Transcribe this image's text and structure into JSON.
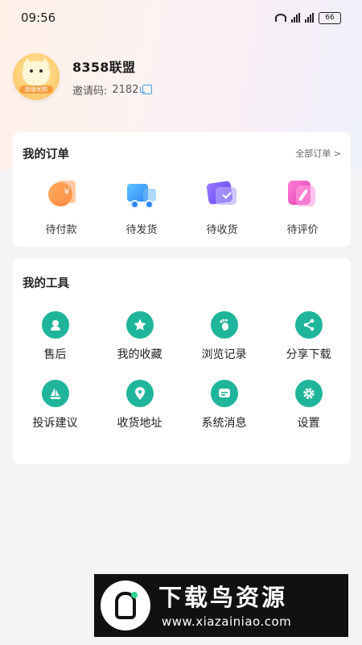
{
  "status_bar": {
    "time": "09:56",
    "battery": "66"
  },
  "profile": {
    "name": "8358联盟",
    "invite_label": "邀请码:",
    "invite_code": "2182",
    "avatar_badge": "超值优购"
  },
  "orders": {
    "title": "我的订单",
    "all_label": "全部订单 >",
    "items": [
      {
        "label": "待付款",
        "icon": "wallet-icon"
      },
      {
        "label": "待发货",
        "icon": "truck-icon"
      },
      {
        "label": "待收货",
        "icon": "card-check-icon"
      },
      {
        "label": "待评价",
        "icon": "edit-note-icon"
      }
    ]
  },
  "tools": {
    "title": "我的工具",
    "items": [
      {
        "label": "售后",
        "icon": "headset-icon"
      },
      {
        "label": "我的收藏",
        "icon": "star-icon"
      },
      {
        "label": "浏览记录",
        "icon": "footprint-icon"
      },
      {
        "label": "分享下载",
        "icon": "share-icon"
      },
      {
        "label": "投诉建议",
        "icon": "complaint-icon"
      },
      {
        "label": "收货地址",
        "icon": "location-pin-icon"
      },
      {
        "label": "系统消息",
        "icon": "message-icon"
      },
      {
        "label": "设置",
        "icon": "gear-icon"
      }
    ]
  },
  "watermark": {
    "title": "下载鸟资源",
    "url": "www.xiazainiao.com"
  },
  "colors": {
    "accent": "#1fb59a",
    "background": "#f4f4f6"
  }
}
